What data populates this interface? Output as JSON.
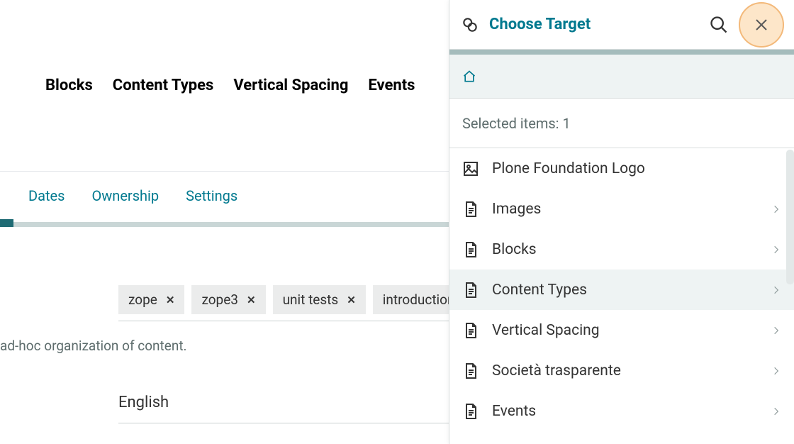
{
  "breadcrumb": [
    "Blocks",
    "Content Types",
    "Vertical Spacing",
    "Events"
  ],
  "tabs": [
    "Dates",
    "Ownership",
    "Settings"
  ],
  "tags": [
    "zope",
    "zope3",
    "unit tests",
    "introduction"
  ],
  "hint": "ad-hoc organization of content.",
  "language": "English",
  "panel": {
    "title": "Choose Target",
    "selected_label": "Selected items: 1",
    "items": [
      {
        "label": "Plone Foundation Logo",
        "icon": "image",
        "nav": false,
        "selected": false
      },
      {
        "label": "Images",
        "icon": "doc",
        "nav": true,
        "selected": false
      },
      {
        "label": "Blocks",
        "icon": "doc",
        "nav": true,
        "selected": false
      },
      {
        "label": "Content Types",
        "icon": "doc",
        "nav": true,
        "selected": true
      },
      {
        "label": "Vertical Spacing",
        "icon": "doc",
        "nav": true,
        "selected": false
      },
      {
        "label": "Società trasparente",
        "icon": "doc",
        "nav": true,
        "selected": false
      },
      {
        "label": "Events",
        "icon": "doc",
        "nav": true,
        "selected": false
      }
    ]
  }
}
